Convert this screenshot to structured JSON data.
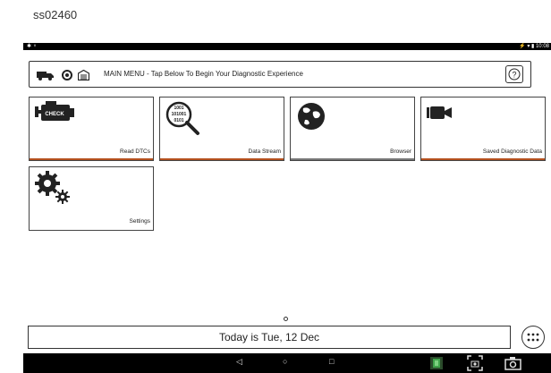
{
  "caption": "ss02460",
  "status_bar": {
    "left_icons": "✱ ♆",
    "right_text": "⚡ ▾ ▮ 10:08"
  },
  "header": {
    "title": "MAIN MENU - Tap Below To Begin Your Diagnostic Experience",
    "help_label": "?"
  },
  "tiles": [
    {
      "label": "Read DTCs",
      "icon": "check-engine-icon",
      "check_text": "CHECK"
    },
    {
      "label": "Data Stream",
      "icon": "magnifier-binary-icon",
      "binary": [
        "1001",
        "101001",
        "0101"
      ]
    },
    {
      "label": "Browser",
      "icon": "globe-icon"
    },
    {
      "label": "Saved Diagnostic Data",
      "icon": "video-camera-icon"
    },
    {
      "label": "Settings",
      "icon": "gears-icon"
    }
  ],
  "date_text": "Today is Tue, 12 Dec",
  "colors": {
    "accent_bar": "#b4501e",
    "neutral_bar": "#777777",
    "statusbar": "#000000"
  },
  "navigation": {
    "back": "◁",
    "home": "○",
    "recents": "□"
  }
}
